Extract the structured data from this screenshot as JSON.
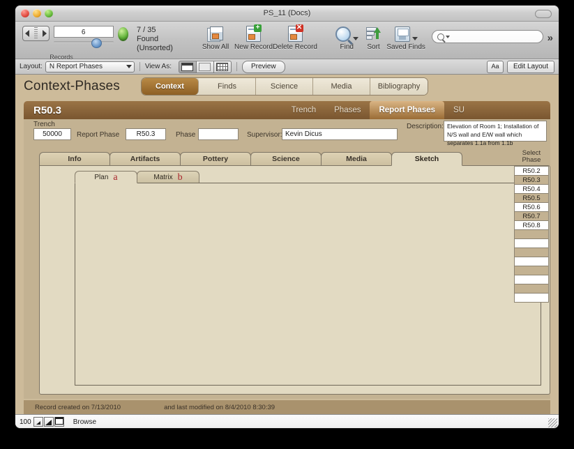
{
  "window": {
    "title": "PS_11 (Docs)",
    "traffic_lights": [
      "close",
      "minimize",
      "zoom"
    ]
  },
  "toolbar": {
    "record_number": "6",
    "found_count": "7 / 35",
    "found_status": "Found (Unsorted)",
    "records_caption": "Records",
    "buttons": [
      {
        "label": "Show All",
        "icon": "show-all-icon"
      },
      {
        "label": "New Record",
        "icon": "new-record-icon"
      },
      {
        "label": "Delete Record",
        "icon": "delete-record-icon"
      },
      {
        "label": "Find",
        "icon": "find-icon"
      },
      {
        "label": "Sort",
        "icon": "sort-icon"
      },
      {
        "label": "Saved Finds",
        "icon": "saved-finds-icon"
      }
    ],
    "search_placeholder": "",
    "overflow_glyph": "»"
  },
  "layout_bar": {
    "layout_label": "Layout:",
    "layout_value": "N Report Phases",
    "view_as_label": "View As:",
    "view_modes": [
      "form-view",
      "list-view",
      "table-view"
    ],
    "active_view": "form-view",
    "preview_label": "Preview",
    "text_format_label": "Aa",
    "edit_layout_label": "Edit Layout"
  },
  "app": {
    "title": "Context-Phases",
    "top_tabs": [
      {
        "label": "Context",
        "active": true
      },
      {
        "label": "Finds",
        "active": false
      },
      {
        "label": "Science",
        "active": false
      },
      {
        "label": "Media",
        "active": false
      },
      {
        "label": "Bibliography",
        "active": false
      }
    ]
  },
  "record": {
    "id": "R50.3",
    "nav_tabs": [
      {
        "label": "Trench",
        "active": false
      },
      {
        "label": "Phases",
        "active": false
      },
      {
        "label": "Report Phases",
        "active": true
      },
      {
        "label": "SU",
        "active": false
      }
    ]
  },
  "form": {
    "trench_label": "Trench",
    "trench_value": "50000",
    "report_phase_label": "Report Phase",
    "report_phase_value": "R50.3",
    "phase_label": "Phase",
    "phase_value": "",
    "supervisor_label": "Supervisor:",
    "supervisor_value": "Kevin Dicus",
    "description_label": "Description:",
    "description_value": "Elevation of Room 1; Installation of N/S wall and E/W wall which separates 1.1a from 1.1b"
  },
  "main_tabs": [
    {
      "label": "Info",
      "active": false
    },
    {
      "label": "Artifacts",
      "active": false
    },
    {
      "label": "Pottery",
      "active": false
    },
    {
      "label": "Science",
      "active": false
    },
    {
      "label": "Media",
      "active": false
    },
    {
      "label": "Sketch",
      "active": true
    }
  ],
  "sub_tabs": [
    {
      "label": "Plan",
      "annotation": "a",
      "active": true
    },
    {
      "label": "Matrix",
      "annotation": "b",
      "active": false
    }
  ],
  "select_phase": {
    "header_line1": "Select",
    "header_line2": "Phase",
    "items": [
      {
        "label": "R50.2",
        "shade": "w"
      },
      {
        "label": "R50.3",
        "shade": "t"
      },
      {
        "label": "R50.4",
        "shade": "w"
      },
      {
        "label": "R50.5",
        "shade": "t"
      },
      {
        "label": "R50.6",
        "shade": "w"
      },
      {
        "label": "R50.7",
        "shade": "t"
      },
      {
        "label": "R50.8",
        "shade": "w"
      },
      {
        "label": "",
        "shade": "t"
      },
      {
        "label": "",
        "shade": "w"
      },
      {
        "label": "",
        "shade": "t"
      },
      {
        "label": "",
        "shade": "w"
      },
      {
        "label": "",
        "shade": "t"
      },
      {
        "label": "",
        "shade": "w"
      },
      {
        "label": "",
        "shade": "t"
      },
      {
        "label": "",
        "shade": "w"
      }
    ]
  },
  "footer": {
    "created_text": "Record created on 7/13/2010",
    "modified_text": "and last modified on 8/4/2010 8:30:39"
  },
  "status_bar": {
    "zoom_level": "100",
    "mode": "Browse"
  },
  "colors": {
    "accent_brown": "#8d5f24",
    "panel_tan": "#c3b292",
    "canvas_cream": "#e2dac2",
    "annotation_red": "#a8232a"
  }
}
